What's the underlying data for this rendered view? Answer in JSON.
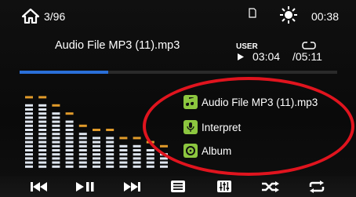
{
  "statusbar": {
    "track_count": "3/96",
    "clock": "00:38",
    "icons": [
      "home-icon",
      "sd-card-icon",
      "brightness-icon"
    ]
  },
  "now_playing": {
    "filename": "Audio File MP3 (11).mp3",
    "eq_mode": "USER",
    "current_time": "03:04",
    "total_time": "/05:11",
    "progress_fraction": 0.28
  },
  "spectrum": {
    "levels": [
      0.83,
      0.79,
      0.72,
      0.63,
      0.46,
      0.4,
      0.4,
      0.34,
      0.34,
      0.25,
      0.2
    ],
    "peak_color": "#e09a2a",
    "bar_color": "#dfe6f0"
  },
  "track_info": {
    "title": "Audio File MP3 (11).mp3",
    "artist": "Interpret",
    "album": "Album"
  },
  "colors": {
    "accent": "#2a6fd8",
    "icon_green": "#8cc63f",
    "annotation_red": "#e0141e"
  },
  "controls": [
    "previous-icon",
    "play-pause-icon",
    "next-icon",
    "playlist-icon",
    "equalizer-icon",
    "shuffle-icon",
    "repeat-icon"
  ]
}
